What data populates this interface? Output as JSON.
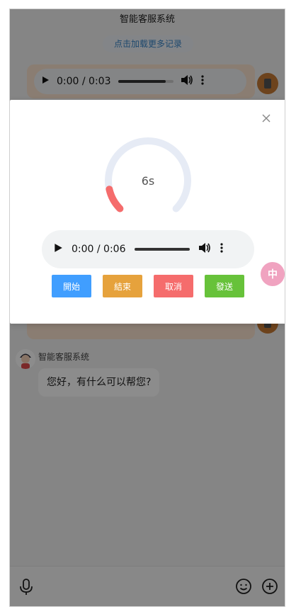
{
  "header": {
    "title": "智能客服系统"
  },
  "history": {
    "load_more_label": "点击加载更多记录"
  },
  "messages": {
    "user_audio_top": {
      "time_label": "0:00 / 0:03",
      "progress": 0.87
    },
    "bot": {
      "name": "智能客服系统",
      "text": "您好，有什么可以帮您?"
    }
  },
  "recorder": {
    "elapsed_label": "6s",
    "ring_progress": 0.12,
    "audio_time_label": "0:00 / 0:06",
    "buttons": {
      "start_label": "開始",
      "stop_label": "結束",
      "cancel_label": "取消",
      "send_label": "發送"
    }
  },
  "side_badge": {
    "label": "中"
  },
  "colors": {
    "start": "#409eff",
    "stop": "#e6a23c",
    "cancel": "#f56c6c",
    "send": "#67c23a",
    "ring_track": "#e6ebf5",
    "ring_progress": "#f56c6c"
  },
  "icons": [
    "close-icon",
    "mic-icon",
    "emoji-icon",
    "plus-icon",
    "play-icon",
    "volume-icon",
    "more-icon"
  ]
}
